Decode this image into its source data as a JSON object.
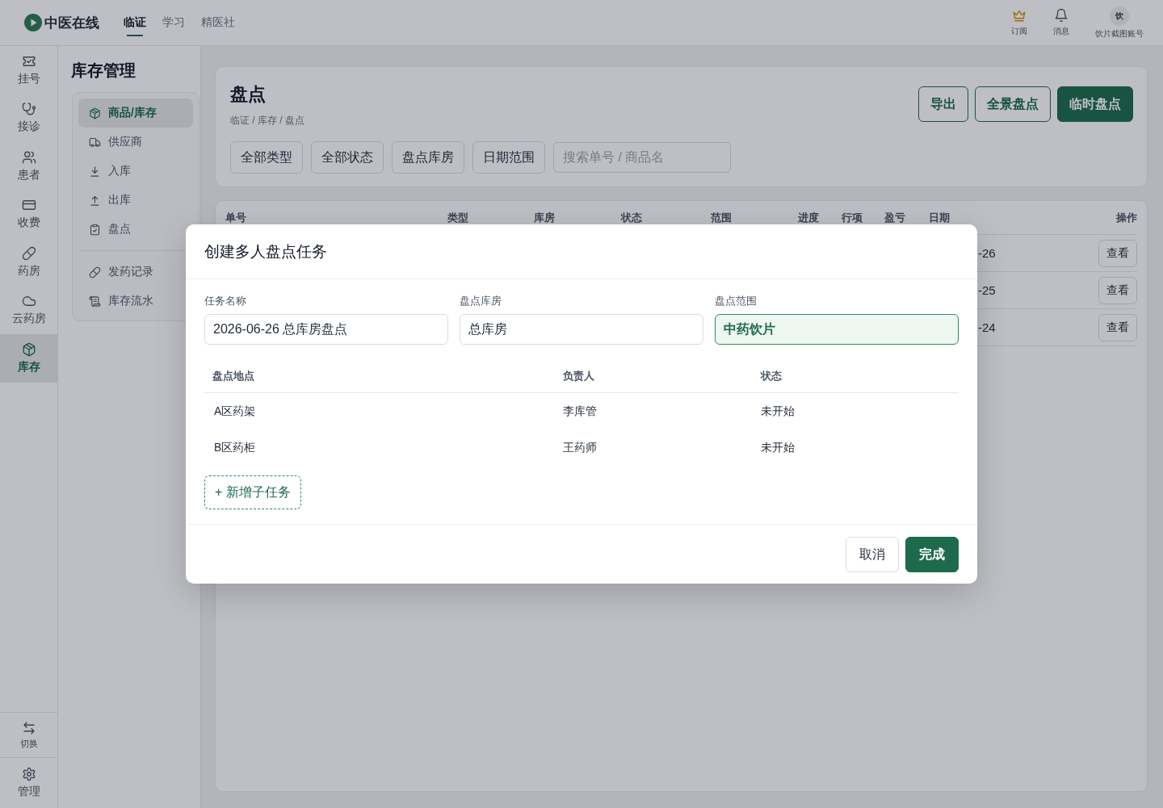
{
  "topbar": {
    "logo": "中医在线",
    "nav": [
      {
        "label": "临证",
        "selected": true
      },
      {
        "label": "学习",
        "selected": false
      },
      {
        "label": "精医社",
        "selected": false
      }
    ],
    "actions": [
      "订阅",
      "消息"
    ],
    "account": {
      "avatar": "饮",
      "name": "饮片截图账号"
    }
  },
  "rail": {
    "items": [
      {
        "label": "挂号",
        "selected": false
      },
      {
        "label": "接诊",
        "selected": false
      },
      {
        "label": "患者",
        "selected": false
      },
      {
        "label": "收费",
        "selected": false
      },
      {
        "label": "药房",
        "selected": false
      },
      {
        "label": "云药房",
        "selected": false
      },
      {
        "label": "库存",
        "selected": true
      }
    ],
    "footer": [
      "切换",
      "管理"
    ]
  },
  "subnav": {
    "title": "库存管理",
    "groups": [
      {
        "items": [
          {
            "label": "商品/库存",
            "selected": true
          },
          {
            "label": "供应商",
            "selected": false
          },
          {
            "label": "入库",
            "selected": false
          },
          {
            "label": "出库",
            "selected": false
          },
          {
            "label": "盘点",
            "selected": false
          }
        ]
      },
      {
        "items": [
          {
            "label": "发药记录",
            "selected": false
          },
          {
            "label": "库存流水",
            "selected": false
          }
        ]
      }
    ]
  },
  "page": {
    "title": "盘点",
    "breadcrumb": "临证 / 库存 / 盘点",
    "buttons": [
      {
        "kind": "outline",
        "label": "导出"
      },
      {
        "kind": "outline",
        "label": "全景盘点"
      },
      {
        "kind": "primary",
        "label": "临时盘点"
      }
    ],
    "filters": [
      "全部类型",
      "全部状态",
      "盘点库房",
      "日期范围"
    ],
    "search": {
      "placeholder": "搜索单号 / 商品名"
    }
  },
  "table": {
    "columns": [
      "单号",
      "类型",
      "库房",
      "状态",
      "范围",
      "进度",
      "行项",
      "盈亏",
      "日期",
      "操作"
    ],
    "rows": [
      {
        "date": "-26",
        "action": "查看"
      },
      {
        "date": "-25",
        "action": "查看"
      },
      {
        "date": "-24",
        "action": "查看"
      }
    ]
  },
  "dialog": {
    "title": "创建多人盘点任务",
    "fields": [
      {
        "label": "任务名称",
        "value": "2026-06-26 总库房盘点",
        "active": false
      },
      {
        "label": "盘点库房",
        "value": "总库房",
        "active": false
      },
      {
        "label": "盘点范围",
        "value": "中药饮片",
        "active": true
      }
    ],
    "subtasks": {
      "columns": [
        "盘点地点",
        "负责人",
        "状态"
      ],
      "rows": [
        [
          "A区药架",
          "李库管",
          "未开始"
        ],
        [
          "B区药柜",
          "王药师",
          "未开始"
        ]
      ]
    },
    "add_button": "+ 新增子任务",
    "buttons": [
      {
        "kind": "secondary",
        "label": "取消"
      },
      {
        "kind": "primary",
        "label": "完成"
      }
    ]
  }
}
